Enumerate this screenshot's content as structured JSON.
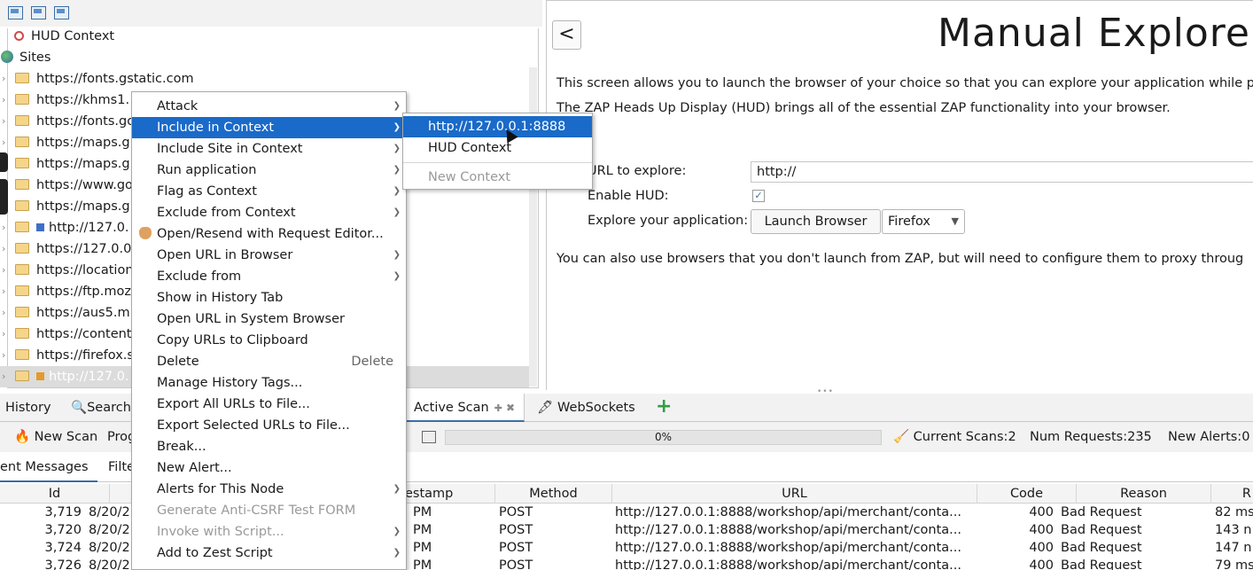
{
  "tree": {
    "context_label": "HUD Context",
    "sites_label": "Sites",
    "rows": [
      "https://fonts.gstatic.com",
      "https://khms1.",
      "https://fonts.go",
      "https://maps.g",
      "https://maps.g",
      "https://www.go",
      "https://maps.g",
      "http://127.0.",
      "https://127.0.0",
      "https://location",
      "https://ftp.moz",
      "https://aus5.m",
      "https://content",
      "https://firefox.s",
      "http://127.0."
    ]
  },
  "manual_explore": {
    "back_label": "<",
    "title": "Manual Explore",
    "para1": "This screen allows you to launch the browser of your choice so that you can explore your application while p",
    "para2": "The ZAP Heads Up Display (HUD) brings all of the essential ZAP functionality into your browser.",
    "url_label": "URL to explore:",
    "url_value": "http://",
    "hud_label": "Enable HUD:",
    "hud_checked": "✓",
    "explore_label": "Explore your application:",
    "launch_button": "Launch Browser",
    "browser_select": "Firefox",
    "para3": "You can also use browsers that you don't launch from ZAP, but will need to configure them to proxy throug"
  },
  "bottom": {
    "tabs": {
      "history": "History",
      "search": "Search",
      "active_scan": "Active Scan",
      "websockets": "WebSockets",
      "add": "+"
    },
    "toolbar": {
      "new_scan": "New Scan",
      "progress_label": "Prog",
      "progress": "0%",
      "current_scans_label": "Current Scans:",
      "current_scans": "2",
      "num_requests_label": "Num Requests:",
      "num_requests": "235",
      "new_alerts_label": "New Alerts:",
      "new_alerts": "0"
    },
    "subtabs": {
      "messages": "ent Messages",
      "filter": "Filte"
    },
    "table": {
      "headers": [
        "Id",
        "estamp",
        "Method",
        "URL",
        "Code",
        "Reason",
        "R"
      ],
      "rows": [
        {
          "id": "3,719",
          "date": "8/20/2",
          "ts": "PM",
          "method": "POST",
          "url": "http://127.0.0.1:8888/workshop/api/merchant/conta...",
          "code": "400",
          "reason": "Bad Request",
          "rtt": "82 ms"
        },
        {
          "id": "3,720",
          "date": "8/20/2",
          "ts": "PM",
          "method": "POST",
          "url": "http://127.0.0.1:8888/workshop/api/merchant/conta...",
          "code": "400",
          "reason": "Bad Request",
          "rtt": "143 n"
        },
        {
          "id": "3,724",
          "date": "8/20/2",
          "ts": "PM",
          "method": "POST",
          "url": "http://127.0.0.1:8888/workshop/api/merchant/conta...",
          "code": "400",
          "reason": "Bad Request",
          "rtt": "147 n"
        },
        {
          "id": "3,726",
          "date": "8/20/2",
          "ts": "PM",
          "method": "POST",
          "url": "http://127.0.0.1:8888/workshop/api/merchant/conta...",
          "code": "400",
          "reason": "Bad Request",
          "rtt": "79 ms"
        }
      ]
    }
  },
  "context_menu": {
    "items": {
      "attack": "Attack",
      "include_in_context": "Include in Context",
      "include_site_in_context": "Include Site in Context",
      "run_application": "Run application",
      "flag_as_context": "Flag as Context",
      "exclude_from_context": "Exclude from Context",
      "open_resend": "Open/Resend with Request Editor...",
      "open_url_in_browser": "Open URL in Browser",
      "exclude_from": "Exclude from",
      "show_in_history": "Show in History Tab",
      "open_url_system": "Open URL in System Browser",
      "copy_urls": "Copy URLs to Clipboard",
      "delete": "Delete",
      "delete_shortcut": "Delete",
      "manage_tags": "Manage History Tags...",
      "export_all": "Export All URLs to File...",
      "export_selected": "Export Selected URLs to File...",
      "break": "Break...",
      "new_alert": "New Alert...",
      "alerts_for_node": "Alerts for This Node",
      "generate_csrf": "Generate Anti-CSRF Test FORM",
      "invoke_script": "Invoke with Script...",
      "add_zest": "Add to Zest Script"
    }
  },
  "submenu": {
    "items": [
      "http://127.0.0.1:8888",
      "HUD Context"
    ],
    "new_context": "New Context"
  },
  "colors": {
    "highlight": "#1a6ac9",
    "accent": "#3a6ea5"
  }
}
